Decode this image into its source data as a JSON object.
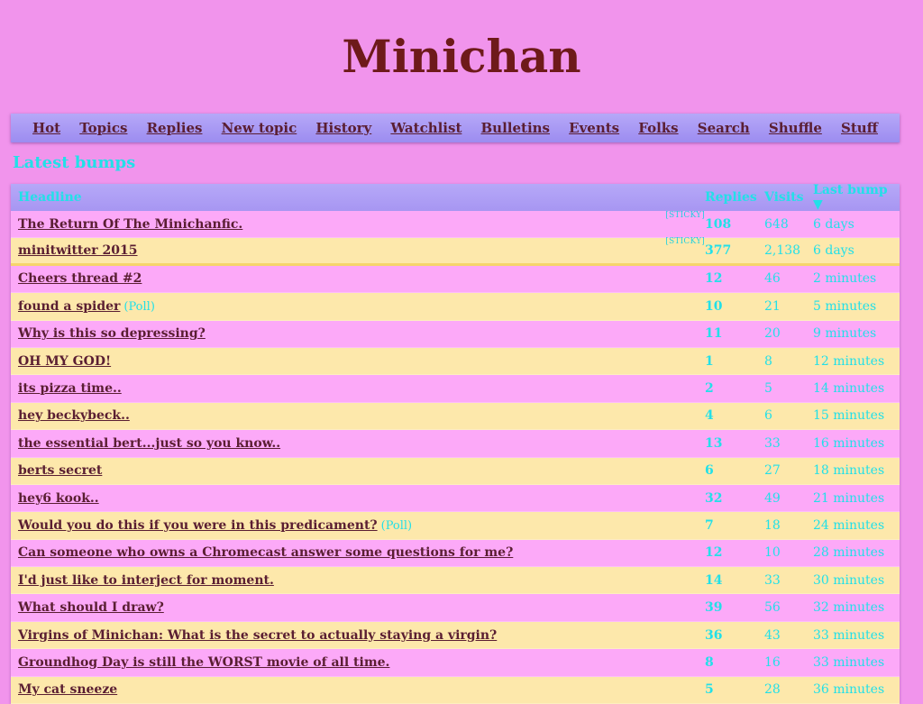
{
  "site_title": "Minichan",
  "nav": [
    "Hot",
    "Topics",
    "Replies",
    "New topic",
    "History",
    "Watchlist",
    "Bulletins",
    "Events",
    "Folks",
    "Search",
    "Shuffle",
    "Stuff"
  ],
  "section_title": "Latest bumps",
  "table": {
    "headers": {
      "headline": "Headline",
      "replies": "Replies",
      "visits": "Visits",
      "last_bump": "Last bump ▼"
    },
    "rows": [
      {
        "headline": "The Return Of The Minichanfic.",
        "tag": "[STICKY]",
        "poll": "",
        "replies": "108",
        "visits": "648",
        "last": "6 days",
        "color": "pink"
      },
      {
        "headline": "minitwitter 2015",
        "tag": "[STICKY]",
        "poll": "",
        "replies": "377",
        "visits": "2,138",
        "last": "6 days",
        "color": "cream"
      },
      {
        "headline": "Cheers thread #2",
        "tag": "",
        "poll": "",
        "replies": "12",
        "visits": "46",
        "last": "2 minutes",
        "color": "pink"
      },
      {
        "headline": "found a spider",
        "tag": "",
        "poll": "(Poll)",
        "replies": "10",
        "visits": "21",
        "last": "5 minutes",
        "color": "cream"
      },
      {
        "headline": "Why is this so depressing?",
        "tag": "",
        "poll": "",
        "replies": "11",
        "visits": "20",
        "last": "9 minutes",
        "color": "pink"
      },
      {
        "headline": "OH MY GOD!",
        "tag": "",
        "poll": "",
        "replies": "1",
        "visits": "8",
        "last": "12 minutes",
        "color": "cream"
      },
      {
        "headline": "its pizza time..",
        "tag": "",
        "poll": "",
        "replies": "2",
        "visits": "5",
        "last": "14 minutes",
        "color": "pink"
      },
      {
        "headline": "hey beckybeck..",
        "tag": "",
        "poll": "",
        "replies": "4",
        "visits": "6",
        "last": "15 minutes",
        "color": "cream"
      },
      {
        "headline": "the essential bert...just so you know..",
        "tag": "",
        "poll": "",
        "replies": "13",
        "visits": "33",
        "last": "16 minutes",
        "color": "pink"
      },
      {
        "headline": "berts secret",
        "tag": "",
        "poll": "",
        "replies": "6",
        "visits": "27",
        "last": "18 minutes",
        "color": "cream"
      },
      {
        "headline": "hey6 kook..",
        "tag": "",
        "poll": "",
        "replies": "32",
        "visits": "49",
        "last": "21 minutes",
        "color": "pink"
      },
      {
        "headline": "Would you do this if you were in this predicament?",
        "tag": "",
        "poll": "(Poll)",
        "replies": "7",
        "visits": "18",
        "last": "24 minutes",
        "color": "cream"
      },
      {
        "headline": "Can someone who owns a Chromecast answer some questions for me?",
        "tag": "",
        "poll": "",
        "replies": "12",
        "visits": "10",
        "last": "28 minutes",
        "color": "pink"
      },
      {
        "headline": "I'd just like to interject for moment.",
        "tag": "",
        "poll": "",
        "replies": "14",
        "visits": "33",
        "last": "30 minutes",
        "color": "cream"
      },
      {
        "headline": "What should I draw?",
        "tag": "",
        "poll": "",
        "replies": "39",
        "visits": "56",
        "last": "32 minutes",
        "color": "pink"
      },
      {
        "headline": "Virgins of Minichan: What is the secret to actually staying a virgin?",
        "tag": "",
        "poll": "",
        "replies": "36",
        "visits": "43",
        "last": "33 minutes",
        "color": "cream"
      },
      {
        "headline": "Groundhog Day is still the WORST movie of all time.",
        "tag": "",
        "poll": "",
        "replies": "8",
        "visits": "16",
        "last": "33 minutes",
        "color": "pink"
      },
      {
        "headline": "My cat sneeze",
        "tag": "",
        "poll": "",
        "replies": "5",
        "visits": "28",
        "last": "36 minutes",
        "color": "cream"
      }
    ]
  }
}
